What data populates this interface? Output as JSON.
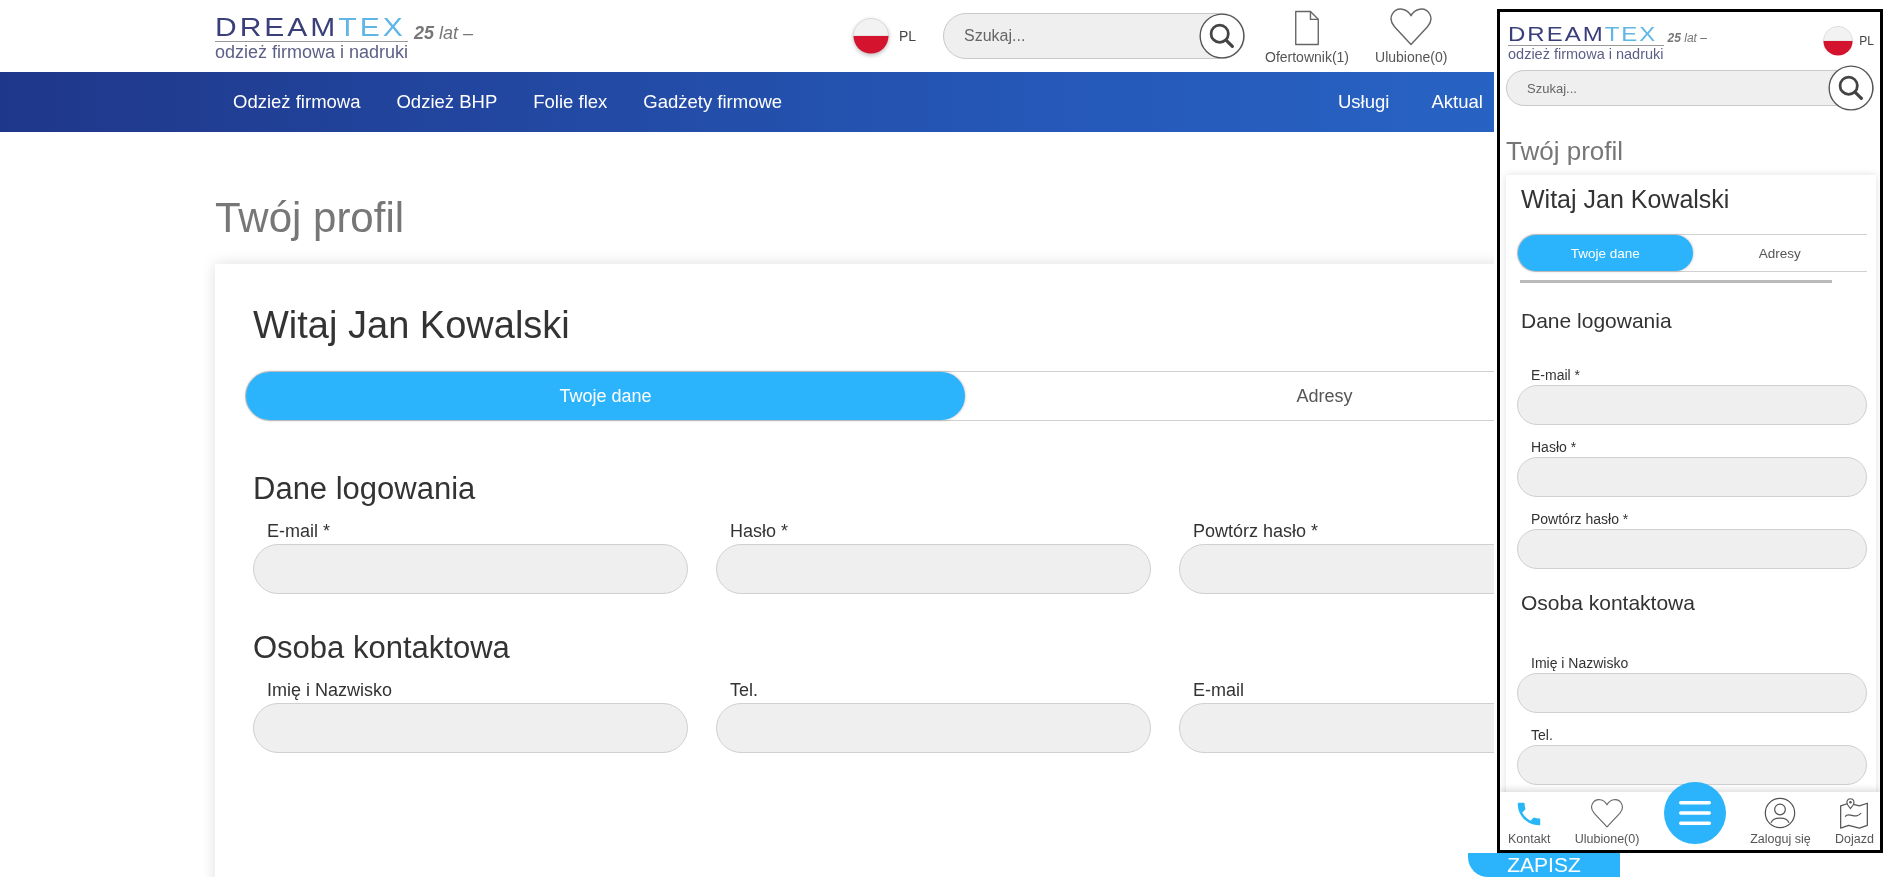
{
  "desktop": {
    "logo": {
      "brand_dark": "DREAM",
      "brand_light": "TEX",
      "tagline": "odzież firmowa i nadruki",
      "anniversary": "**25** lat –"
    },
    "language": "PL",
    "search": {
      "placeholder": "Szukaj..."
    },
    "header_links": [
      {
        "label": "Ofertownik(1)",
        "kind": "document"
      },
      {
        "label": "Ulubione(0)",
        "kind": "heart"
      }
    ],
    "nav_left": [
      "Odzież firmowa",
      "Odzież BHP",
      "Folie flex",
      "Gadżety firmowe"
    ],
    "nav_right": [
      "Usługi",
      "Aktual"
    ],
    "page_title": "Twój profil",
    "greeting": "Witaj Jan Kowalski",
    "tabs": [
      {
        "label": "Twoje dane",
        "selected": true
      },
      {
        "label": "Adresy",
        "selected": false
      }
    ],
    "sections": [
      {
        "title": "Dane logowania",
        "fields": [
          "E-mail *",
          "Hasło *",
          "Powtórz hasło *"
        ]
      },
      {
        "title": "Osoba kontaktowa",
        "fields": [
          "Imię i Nazwisko",
          "Tel.",
          "E-mail"
        ]
      }
    ],
    "save_button": "ZAPISZ"
  },
  "mobile": {
    "logo": {
      "brand_dark": "DREAM",
      "brand_light": "TEX",
      "tagline": "odzież firmowa i nadruki",
      "anniversary": "**25** lat –"
    },
    "language": "PL",
    "search": {
      "placeholder": "Szukaj..."
    },
    "page_title": "Twój profil",
    "greeting": "Witaj Jan Kowalski",
    "tabs": [
      {
        "label": "Twoje dane",
        "selected": true
      },
      {
        "label": "Adresy",
        "selected": false
      }
    ],
    "sections": [
      {
        "title": "Dane logowania",
        "fields": [
          "E-mail *",
          "Hasło *",
          "Powtórz hasło *"
        ]
      },
      {
        "title": "Osoba kontaktowa",
        "fields": [
          "Imię i Nazwisko",
          "Tel."
        ]
      }
    ],
    "bottom_nav": [
      {
        "label": "Kontakt",
        "kind": "phone"
      },
      {
        "label": "Ulubione(0)",
        "kind": "heart"
      },
      {
        "kind": "menu"
      },
      {
        "label": "Zaloguj się",
        "kind": "user"
      },
      {
        "label": "Dojazd",
        "kind": "map"
      }
    ]
  }
}
